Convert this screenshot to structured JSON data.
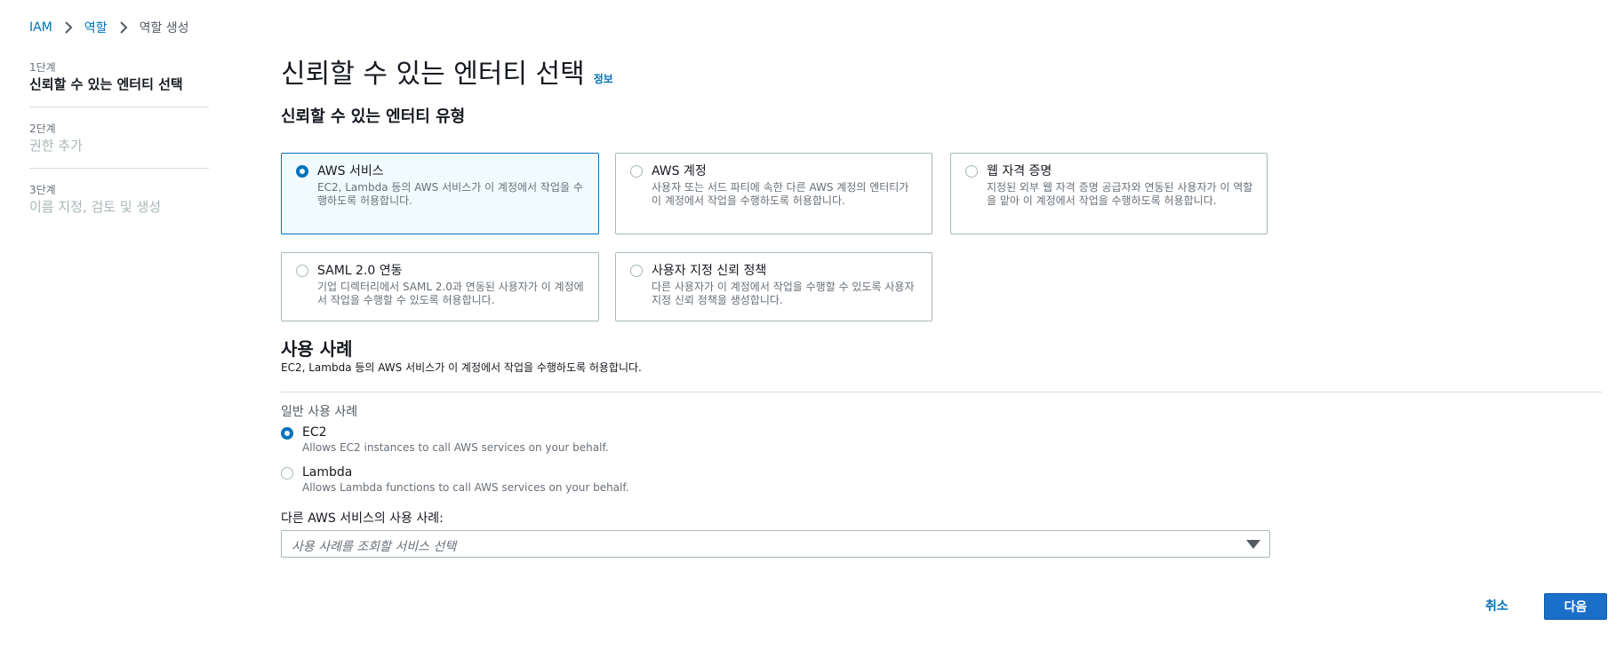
{
  "breadcrumb": {
    "items": [
      "IAM",
      "역할"
    ],
    "current": "역할 생성"
  },
  "steps": [
    {
      "num": "1단계",
      "title": "신뢰할 수 있는 엔터티 선택",
      "active": true
    },
    {
      "num": "2단계",
      "title": "권한 추가",
      "active": false
    },
    {
      "num": "3단계",
      "title": "이름 지정, 검토 및 생성",
      "active": false
    }
  ],
  "page": {
    "title": "신뢰할 수 있는 엔터티 선택",
    "info": "정보",
    "section_title": "신뢰할 수 있는 엔터티 유형"
  },
  "entity_types": [
    {
      "title": "AWS 서비스",
      "desc": "EC2, Lambda 등의 AWS 서비스가 이 계정에서 작업을 수행하도록 허용합니다.",
      "selected": true
    },
    {
      "title": "AWS 계정",
      "desc": "사용자 또는 서드 파티에 속한 다른 AWS 계정의 엔터티가 이 계정에서 작업을 수행하도록 허용합니다.",
      "selected": false
    },
    {
      "title": "웹 자격 증명",
      "desc": "지정된 외부 웹 자격 증명 공급자와 연동된 사용자가 이 역할을 맡아 이 계정에서 작업을 수행하도록 허용합니다.",
      "selected": false
    },
    {
      "title": "SAML 2.0 연동",
      "desc": "기업 디렉터리에서 SAML 2.0과 연동된 사용자가 이 계정에서 작업을 수행할 수 있도록 허용합니다.",
      "selected": false
    },
    {
      "title": "사용자 지정 신뢰 정책",
      "desc": "다른 사용자가 이 계정에서 작업을 수행할 수 있도록 사용자 지정 신뢰 정책을 생성합니다.",
      "selected": false
    }
  ],
  "use_case": {
    "title": "사용 사례",
    "desc": "EC2, Lambda 등의 AWS 서비스가 이 계정에서 작업을 수행하도록 허용합니다.",
    "common_label": "일반 사용 사례",
    "options": [
      {
        "title": "EC2",
        "desc": "Allows EC2 instances to call AWS services on your behalf.",
        "selected": true
      },
      {
        "title": "Lambda",
        "desc": "Allows Lambda functions to call AWS services on your behalf.",
        "selected": false
      }
    ],
    "other_label": "다른 AWS 서비스의 사용 사례:",
    "select_placeholder": "사용 사례를 조회할 서비스 선택"
  },
  "footer": {
    "cancel": "취소",
    "next": "다음"
  },
  "colors": {
    "link": "#0073bb",
    "primary_button": "#1a6fc9",
    "selected_tile_bg": "#f1faff"
  }
}
